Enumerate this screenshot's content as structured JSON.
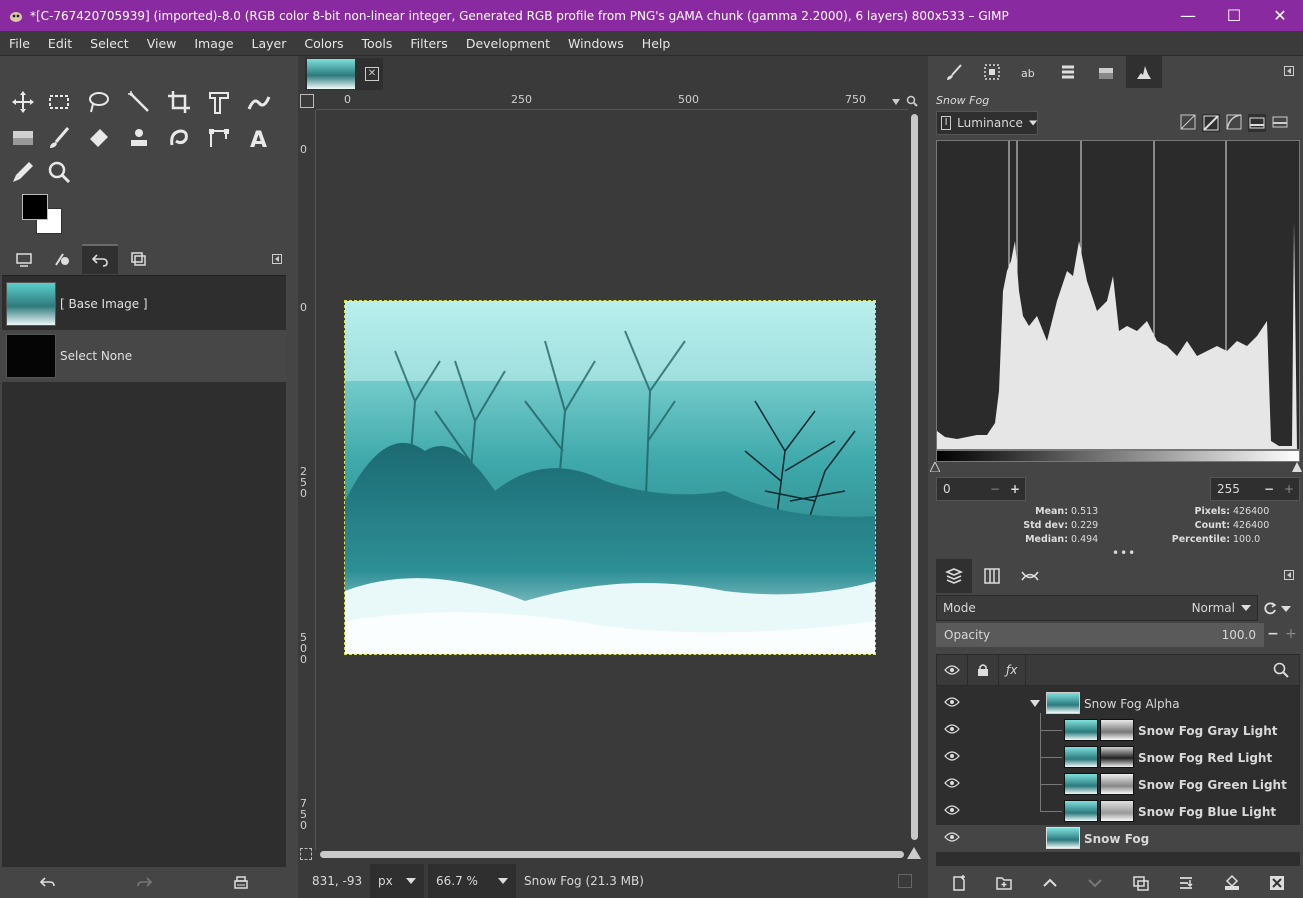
{
  "window": {
    "title": "*[C-767420705939] (imported)-8.0 (RGB color 8-bit non-linear integer, Generated RGB profile from PNG's gAMA chunk (gamma 2.2000), 6 layers) 800x533 – GIMP",
    "minimize": "—",
    "maximize": "☐",
    "close": "✕"
  },
  "menu": [
    "File",
    "Edit",
    "Select",
    "View",
    "Image",
    "Layer",
    "Colors",
    "Tools",
    "Filters",
    "Development",
    "Windows",
    "Help"
  ],
  "undo_history": [
    {
      "label": "[ Base Image ]"
    },
    {
      "label": "Select None"
    }
  ],
  "canvas": {
    "hruler_labels": [
      "0",
      "250",
      "500",
      "750"
    ],
    "vruler_labels": [
      "0",
      "250",
      "500",
      "750"
    ],
    "vruler_mid": "0"
  },
  "status": {
    "coords": "831, -93",
    "unit": "px",
    "zoom": "66.7 %",
    "layer_info": "Snow Fog (21.3 MB)"
  },
  "histogram": {
    "panel_title": "Snow Fog",
    "channel": "Luminance",
    "range_min": "0",
    "range_max": "255",
    "stats_left": [
      {
        "k": "Mean:",
        "v": "0.513"
      },
      {
        "k": "Std dev:",
        "v": "0.229"
      },
      {
        "k": "Median:",
        "v": "0.494"
      }
    ],
    "stats_right": [
      {
        "k": "Pixels:",
        "v": "426400"
      },
      {
        "k": "Count:",
        "v": "426400"
      },
      {
        "k": "Percentile:",
        "v": "100.0"
      }
    ]
  },
  "layers": {
    "mode_label": "Mode",
    "mode_value": "Normal",
    "opacity_label": "Opacity",
    "opacity_value": "100.0",
    "items": [
      {
        "name": "Snow Fog Alpha",
        "indent": 1,
        "group": true,
        "bold": false,
        "mask": false
      },
      {
        "name": "Snow Fog Gray Light",
        "indent": 2,
        "group": false,
        "bold": true,
        "mask": true
      },
      {
        "name": "Snow Fog Red Light",
        "indent": 2,
        "group": false,
        "bold": true,
        "mask": true
      },
      {
        "name": "Snow Fog Green Light",
        "indent": 2,
        "group": false,
        "bold": true,
        "mask": true
      },
      {
        "name": "Snow Fog Blue Light",
        "indent": 2,
        "group": false,
        "bold": true,
        "mask": true
      },
      {
        "name": "Snow Fog",
        "indent": 0,
        "group": false,
        "bold": true,
        "mask": false,
        "selected": true
      }
    ]
  },
  "colors": {
    "titlebar": "#8a2aa0",
    "selection": "#d8e34a",
    "teal": "#2a8a8c"
  }
}
